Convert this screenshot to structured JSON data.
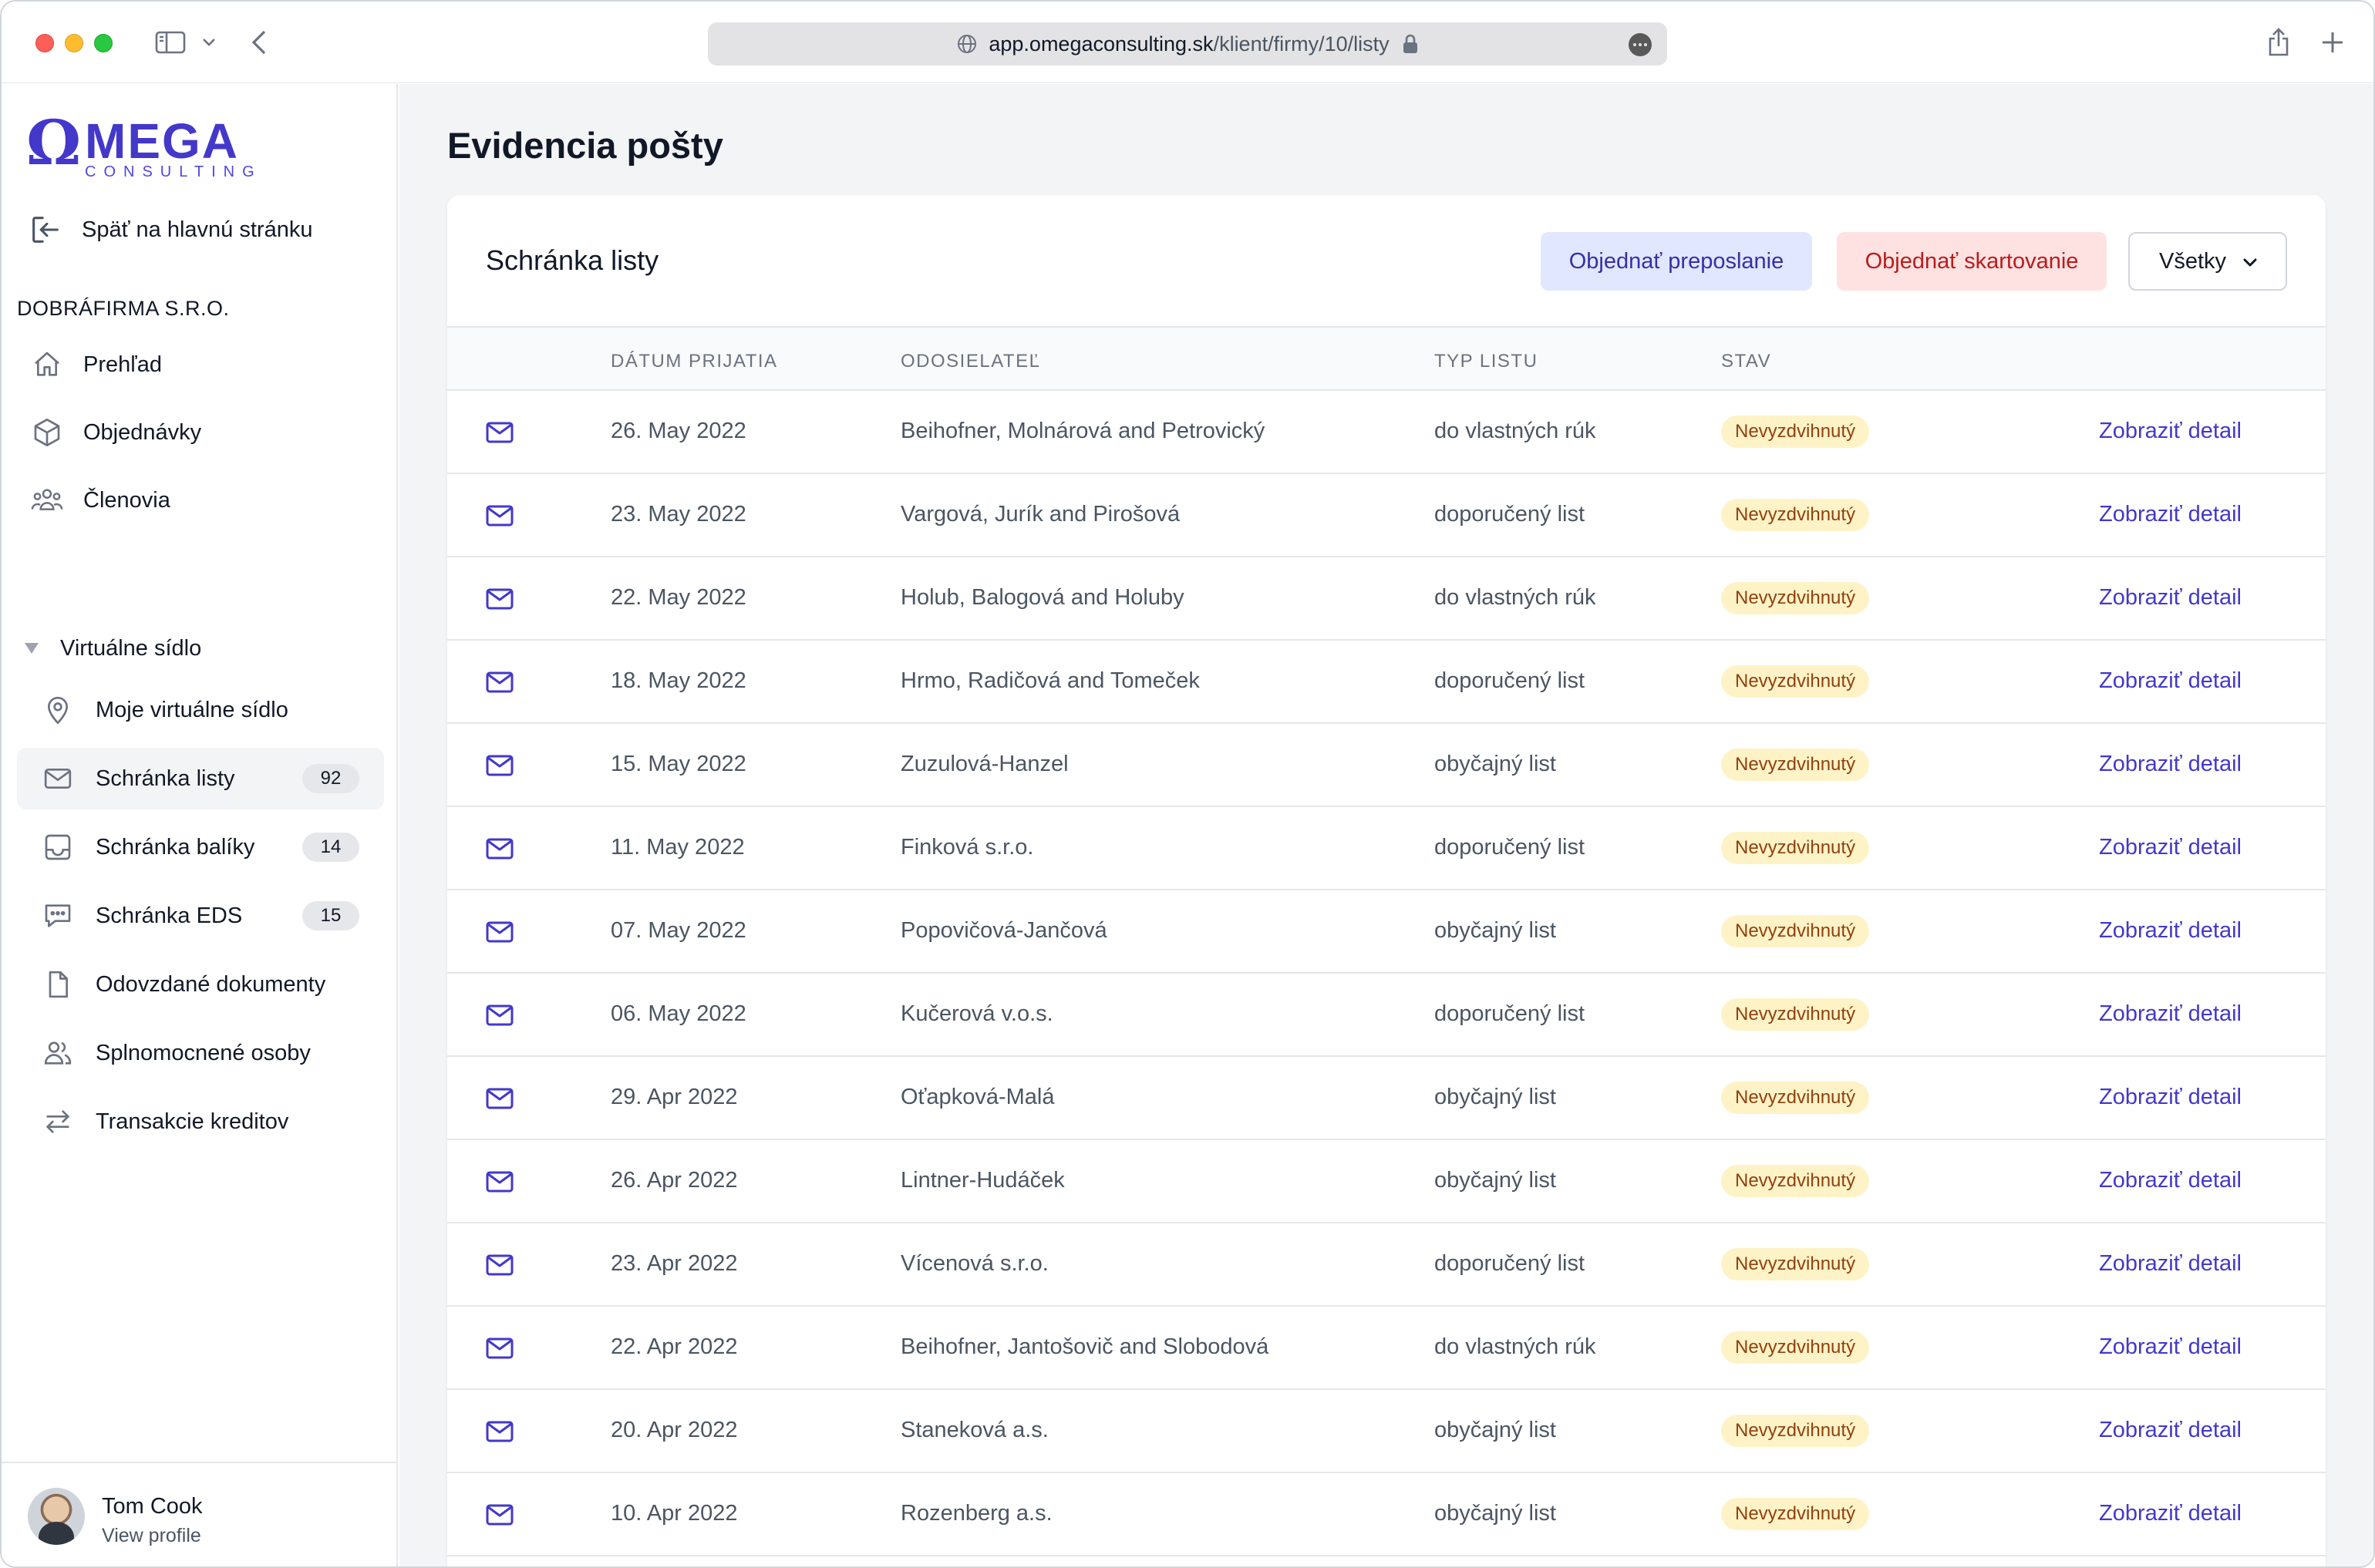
{
  "browser": {
    "url_host": "app.omegaconsulting.sk",
    "url_path": "/klient/firmy/10/listy"
  },
  "brand": {
    "omega_symbol": "Ω",
    "name_rest": "MEGA",
    "subtitle": "CONSULTING",
    "accent_color": "#4338ca"
  },
  "sidebar": {
    "back_label": "Späť na hlavnú stránku",
    "company": "DOBRÁFIRMA S.R.O.",
    "items": [
      {
        "label": "Prehľad",
        "icon": "home-icon"
      },
      {
        "label": "Objednávky",
        "icon": "cube-icon"
      },
      {
        "label": "Členovia",
        "icon": "users-icon"
      }
    ],
    "group": {
      "label": "Virtuálne sídlo",
      "items": [
        {
          "label": "Moje virtuálne sídlo",
          "icon": "map-pin-icon"
        },
        {
          "label": "Schránka listy",
          "icon": "mail-icon",
          "badge": "92",
          "active": true
        },
        {
          "label": "Schránka balíky",
          "icon": "inbox-icon",
          "badge": "14"
        },
        {
          "label": "Schránka EDS",
          "icon": "chat-icon",
          "badge": "15"
        },
        {
          "label": "Odovzdané dokumenty",
          "icon": "document-icon"
        },
        {
          "label": "Splnomocnené osoby",
          "icon": "user-group-icon"
        },
        {
          "label": "Transakcie kreditov",
          "icon": "arrows-switch-icon"
        }
      ]
    },
    "profile": {
      "name": "Tom Cook",
      "link": "View profile"
    }
  },
  "main": {
    "title": "Evidencia pošty",
    "card": {
      "title": "Schránka listy",
      "btn_forward": "Objednať preposlanie",
      "btn_shred": "Objednať skartovanie",
      "filter_value": "Všetky"
    },
    "table": {
      "headers": {
        "date": "DÁTUM PRIJATIA",
        "sender": "ODOSIELATEĽ",
        "type": "TYP LISTU",
        "status": "STAV"
      },
      "detail_label": "Zobraziť detail",
      "rows": [
        {
          "date": "26. May 2022",
          "sender": "Beihofner, Molnárová and Petrovický",
          "type": "do vlastných rúk",
          "status": "Nevyzdvihnutý"
        },
        {
          "date": "23. May 2022",
          "sender": "Vargová, Jurík and Pirošová",
          "type": "doporučený list",
          "status": "Nevyzdvihnutý"
        },
        {
          "date": "22. May 2022",
          "sender": "Holub, Balogová and Holuby",
          "type": "do vlastných rúk",
          "status": "Nevyzdvihnutý"
        },
        {
          "date": "18. May 2022",
          "sender": "Hrmo, Radičová and Tomeček",
          "type": "doporučený list",
          "status": "Nevyzdvihnutý"
        },
        {
          "date": "15. May 2022",
          "sender": "Zuzulová-Hanzel",
          "type": "obyčajný list",
          "status": "Nevyzdvihnutý"
        },
        {
          "date": "11. May 2022",
          "sender": "Finková s.r.o.",
          "type": "doporučený list",
          "status": "Nevyzdvihnutý"
        },
        {
          "date": "07. May 2022",
          "sender": "Popovičová-Jančová",
          "type": "obyčajný list",
          "status": "Nevyzdvihnutý"
        },
        {
          "date": "06. May 2022",
          "sender": "Kučerová v.o.s.",
          "type": "doporučený list",
          "status": "Nevyzdvihnutý"
        },
        {
          "date": "29. Apr 2022",
          "sender": "Oťapková-Malá",
          "type": "obyčajný list",
          "status": "Nevyzdvihnutý"
        },
        {
          "date": "26. Apr 2022",
          "sender": "Lintner-Hudáček",
          "type": "obyčajný list",
          "status": "Nevyzdvihnutý"
        },
        {
          "date": "23. Apr 2022",
          "sender": "Vícenová s.r.o.",
          "type": "doporučený list",
          "status": "Nevyzdvihnutý"
        },
        {
          "date": "22. Apr 2022",
          "sender": "Beihofner, Jantošovič and Slobodová",
          "type": "do vlastných rúk",
          "status": "Nevyzdvihnutý"
        },
        {
          "date": "20. Apr 2022",
          "sender": "Staneková a.s.",
          "type": "obyčajný list",
          "status": "Nevyzdvihnutý"
        },
        {
          "date": "10. Apr 2022",
          "sender": "Rozenberg a.s.",
          "type": "obyčajný list",
          "status": "Nevyzdvihnutý"
        }
      ]
    }
  }
}
